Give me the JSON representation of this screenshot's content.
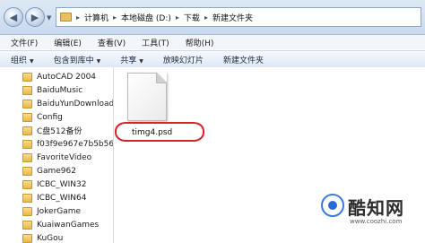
{
  "address_bar": {
    "breadcrumbs": [
      "计算机",
      "本地磁盘 (D:)",
      "下载",
      "新建文件夹"
    ]
  },
  "menu_bar": {
    "items": [
      "文件(F)",
      "编辑(E)",
      "查看(V)",
      "工具(T)",
      "帮助(H)"
    ]
  },
  "toolbar": {
    "items": [
      "组织",
      "包含到库中",
      "共享",
      "放映幻灯片",
      "新建文件夹"
    ]
  },
  "nav_pane": {
    "items": [
      "AutoCAD 2004",
      "BaiduMusic",
      "BaiduYunDownload",
      "Config",
      "C盘512备份",
      "f03f9e967e7b5b56",
      "FavoriteVideo",
      "Game962",
      "ICBC_WIN32",
      "ICBC_WIN64",
      "JokerGame",
      "KuaiwanGames",
      "KuGou"
    ]
  },
  "content": {
    "file": {
      "name": "timg4.psd",
      "icon": "document-icon"
    },
    "highlight_color": "#d9232b"
  },
  "watermark": {
    "title": "酷知网",
    "url": "www.coozhi.com"
  }
}
